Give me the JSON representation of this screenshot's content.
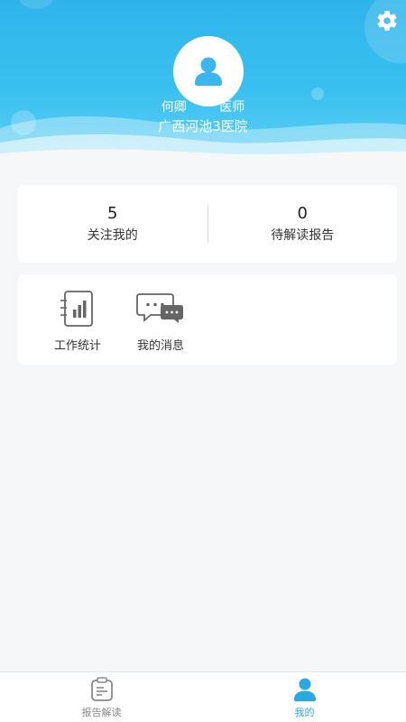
{
  "profile": {
    "name": "何卿",
    "title": "医师",
    "hospital": "广西河池3医院"
  },
  "stats": [
    {
      "value": "5",
      "label": "关注我的"
    },
    {
      "value": "0",
      "label": "待解读报告"
    }
  ],
  "tools": [
    {
      "label": "工作统计",
      "icon": "bar-chart-document-icon"
    },
    {
      "label": "我的消息",
      "icon": "chat-bubbles-icon"
    }
  ],
  "tabbar": {
    "items": [
      {
        "label": "报告解读",
        "icon": "report-clipboard-icon",
        "active": false
      },
      {
        "label": "我的",
        "icon": "person-icon",
        "active": true
      }
    ]
  },
  "colors": {
    "header": "#2fb4ea",
    "active_tab": "#2aa8e0",
    "inactive_tab": "#888888"
  }
}
